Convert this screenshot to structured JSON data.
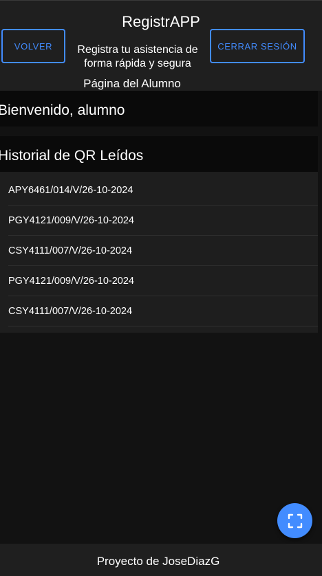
{
  "header": {
    "title": "RegistrAPP",
    "subtitle": "Registra tu asistencia de forma rápida y segura",
    "page_label": "Página del Alumno",
    "back_label": "VOLVER",
    "logout_label": "CERRAR SESIÓN"
  },
  "welcome": {
    "text": "Bienvenido, alumno"
  },
  "history": {
    "title": "Historial de QR Leídos",
    "items": [
      "APY6461/014/V/26-10-2024",
      "PGY4121/009/V/26-10-2024",
      "CSY4111/007/V/26-10-2024",
      "PGY4121/009/V/26-10-2024",
      "CSY4111/007/V/26-10-2024"
    ]
  },
  "fab": {
    "icon": "qr-scan-icon"
  },
  "footer": {
    "text": "Proyecto de JoseDiazG"
  },
  "colors": {
    "accent": "#428cff",
    "toolbar": "#1f1f1f",
    "background": "#121212",
    "card": "#1e1e1e"
  }
}
